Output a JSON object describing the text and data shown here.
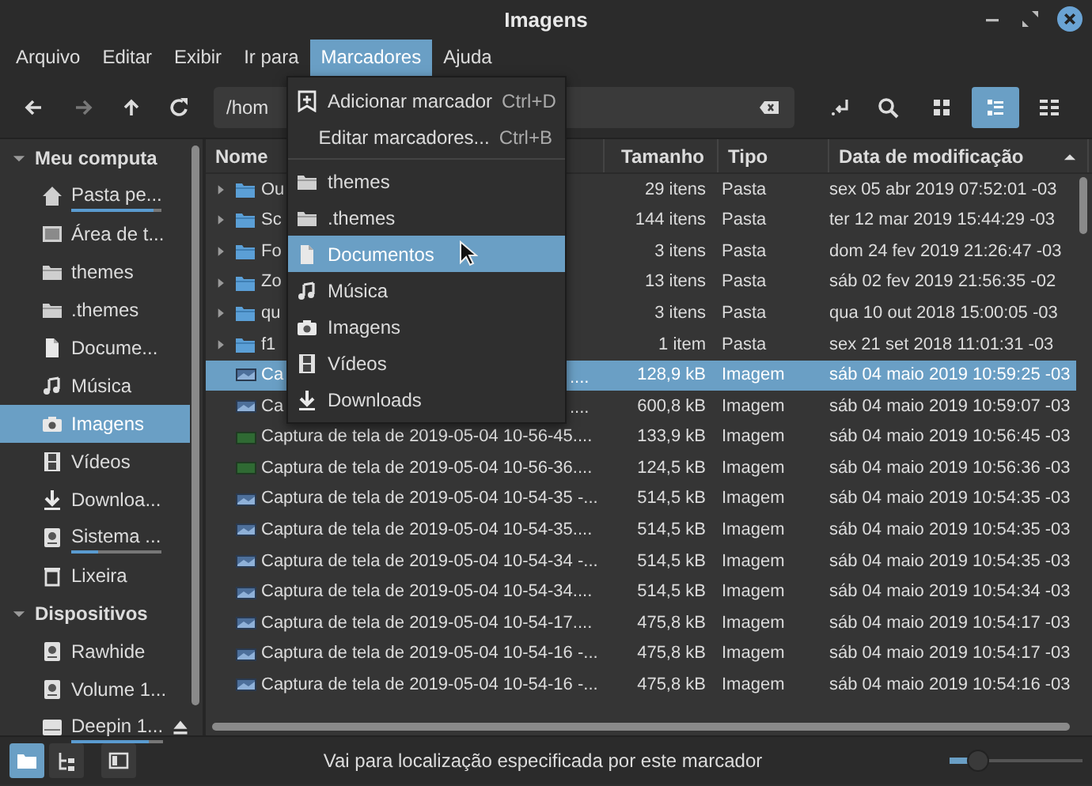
{
  "window": {
    "title": "Imagens"
  },
  "menu_bar": [
    {
      "label": "Arquivo",
      "selected": false
    },
    {
      "label": "Editar",
      "selected": false
    },
    {
      "label": "Exibir",
      "selected": false
    },
    {
      "label": "Ir para",
      "selected": false
    },
    {
      "label": "Marcadores",
      "selected": true
    },
    {
      "label": "Ajuda",
      "selected": false
    }
  ],
  "toolbar": {
    "path": "/hom",
    "forward_disabled": true,
    "view_buttons": [
      {
        "kind": "icons",
        "selected": false
      },
      {
        "kind": "list",
        "selected": true
      },
      {
        "kind": "compact",
        "selected": false
      }
    ]
  },
  "sidebar": {
    "sections": [
      {
        "title": "Meu computa",
        "expanded": true,
        "items": [
          {
            "kind": "home",
            "label": "Pasta pe...",
            "selected": false,
            "level": 0.9
          },
          {
            "kind": "desktop",
            "label": "Área de t...",
            "selected": false
          },
          {
            "kind": "folder",
            "label": "themes",
            "selected": false
          },
          {
            "kind": "folder",
            "label": ".themes",
            "selected": false
          },
          {
            "kind": "document",
            "label": "Docume...",
            "selected": false
          },
          {
            "kind": "music",
            "label": "Música",
            "selected": false
          },
          {
            "kind": "camera",
            "label": "Imagens",
            "selected": true
          },
          {
            "kind": "film",
            "label": "Vídeos",
            "selected": false
          },
          {
            "kind": "download",
            "label": "Downloa...",
            "selected": false
          },
          {
            "kind": "disk",
            "label": "Sistema ...",
            "selected": false,
            "level": 0.3
          },
          {
            "kind": "trash",
            "label": "Lixeira",
            "selected": false
          }
        ]
      },
      {
        "title": "Dispositivos",
        "expanded": true,
        "items": [
          {
            "kind": "disk",
            "label": "Rawhide",
            "selected": false
          },
          {
            "kind": "disk",
            "label": "Volume 1...",
            "selected": false
          },
          {
            "kind": "drive",
            "label": "Deepin 1...",
            "selected": false,
            "level": 0.85,
            "ejectable": true
          }
        ]
      }
    ]
  },
  "files": {
    "columns": [
      {
        "label": "Nome",
        "sorted": false
      },
      {
        "label": "Tamanho",
        "sorted": false
      },
      {
        "label": "Tipo",
        "sorted": false
      },
      {
        "label": "Data de modificação",
        "sorted": true
      }
    ],
    "rows": [
      {
        "kind": "folder",
        "name": "Ou",
        "size": "29 itens",
        "type": "Pasta",
        "date": "sex 05 abr 2019 07:52:01 -03",
        "selected": false
      },
      {
        "kind": "folder",
        "name": "Sc",
        "size": "144 itens",
        "type": "Pasta",
        "date": "ter 12 mar 2019 15:44:29 -03",
        "selected": false
      },
      {
        "kind": "folder",
        "name": "Fo",
        "size": "3 itens",
        "type": "Pasta",
        "date": "dom 24 fev 2019 21:26:47 -03",
        "selected": false
      },
      {
        "kind": "folder",
        "name": "Zo",
        "size": "13 itens",
        "type": "Pasta",
        "date": "sáb 02 fev 2019 21:56:35 -02",
        "selected": false
      },
      {
        "kind": "folder",
        "name": "qu",
        "size": "3 itens",
        "type": "Pasta",
        "date": "qua 10 out 2018 15:00:05 -03",
        "selected": false
      },
      {
        "kind": "folder",
        "name": "f1",
        "size": "1 item",
        "type": "Pasta",
        "date": "sex 21 set 2018 11:01:31 -03",
        "selected": false
      },
      {
        "kind": "image",
        "name": "Ca",
        "name_tail": "....",
        "size": "128,9 kB",
        "type": "Imagem",
        "date": "sáb 04 maio 2019 10:59:25 -03",
        "selected": true
      },
      {
        "kind": "image",
        "name": "Ca",
        "name_tail": "....",
        "size": "600,8 kB",
        "type": "Imagem",
        "date": "sáb 04 maio 2019 10:59:07 -03",
        "selected": false
      },
      {
        "kind": "image",
        "name": "Captura de tela de 2019-05-04 10-56-45....",
        "size": "133,9 kB",
        "type": "Imagem",
        "date": "sáb 04 maio 2019 10:56:45 -03",
        "selected": false
      },
      {
        "kind": "image",
        "name": "Captura de tela de 2019-05-04 10-56-36....",
        "size": "124,5 kB",
        "type": "Imagem",
        "date": "sáb 04 maio 2019 10:56:36 -03",
        "selected": false
      },
      {
        "kind": "image",
        "name": "Captura de tela de 2019-05-04 10-54-35 -...",
        "size": "514,5 kB",
        "type": "Imagem",
        "date": "sáb 04 maio 2019 10:54:35 -03",
        "selected": false
      },
      {
        "kind": "image",
        "name": "Captura de tela de 2019-05-04 10-54-35....",
        "size": "514,5 kB",
        "type": "Imagem",
        "date": "sáb 04 maio 2019 10:54:35 -03",
        "selected": false
      },
      {
        "kind": "image",
        "name": "Captura de tela de 2019-05-04 10-54-34 -...",
        "size": "514,5 kB",
        "type": "Imagem",
        "date": "sáb 04 maio 2019 10:54:35 -03",
        "selected": false
      },
      {
        "kind": "image",
        "name": "Captura de tela de 2019-05-04 10-54-34....",
        "size": "514,5 kB",
        "type": "Imagem",
        "date": "sáb 04 maio 2019 10:54:34 -03",
        "selected": false
      },
      {
        "kind": "image",
        "name": "Captura de tela de 2019-05-04 10-54-17....",
        "size": "475,8 kB",
        "type": "Imagem",
        "date": "sáb 04 maio 2019 10:54:17 -03",
        "selected": false
      },
      {
        "kind": "image",
        "name": "Captura de tela de 2019-05-04 10-54-16 -...",
        "size": "475,8 kB",
        "type": "Imagem",
        "date": "sáb 04 maio 2019 10:54:17 -03",
        "selected": false
      },
      {
        "kind": "image",
        "name": "Captura de tela de 2019-05-04 10-54-16 -...",
        "size": "475,8 kB",
        "type": "Imagem",
        "date": "sáb 04 maio 2019 10:54:16 -03",
        "selected": false
      }
    ]
  },
  "bookmarks_menu": {
    "items": [
      {
        "kind": "add",
        "label": "Adicionar marcador",
        "shortcut": "Ctrl+D",
        "selected": false
      },
      {
        "kind": "edit",
        "label": "Editar marcadores...",
        "shortcut": "Ctrl+B",
        "selected": false
      },
      {
        "kind": "separator"
      },
      {
        "kind": "folder",
        "label": "themes",
        "selected": false
      },
      {
        "kind": "folder",
        "label": ".themes",
        "selected": false
      },
      {
        "kind": "document",
        "label": "Documentos",
        "selected": true
      },
      {
        "kind": "music",
        "label": "Música",
        "selected": false
      },
      {
        "kind": "camera",
        "label": "Imagens",
        "selected": false
      },
      {
        "kind": "film",
        "label": "Vídeos",
        "selected": false
      },
      {
        "kind": "download",
        "label": "Downloads",
        "selected": false
      }
    ]
  },
  "status_bar": {
    "buttons": [
      {
        "kind": "places",
        "selected": true
      },
      {
        "kind": "tree",
        "selected": false
      },
      {
        "kind": "sidebar",
        "selected": false
      }
    ],
    "message": "Vai para localização especificada por este marcador",
    "zoom": {
      "level": 0.15
    }
  }
}
